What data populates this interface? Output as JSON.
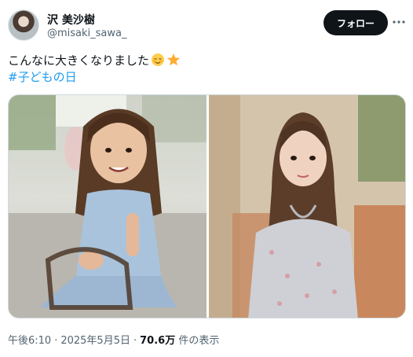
{
  "author": {
    "name": "沢 美沙樹",
    "handle": "@misaki_sawa_",
    "avatar": "avatar-photo"
  },
  "actions": {
    "follow_label": "フォロー",
    "more_icon": "more-horizontal-icon"
  },
  "tweet": {
    "text": "こんなに大きくなりました",
    "emojis": [
      "relieved-face-emoji",
      "star-emoji"
    ],
    "hashtag": "#子どもの日"
  },
  "media": {
    "images": [
      {
        "name": "childhood-photo"
      },
      {
        "name": "current-photo"
      }
    ]
  },
  "meta": {
    "time": "午後6:10",
    "date": "2025年5月5日",
    "views_count": "70.6万",
    "views_label": "件の表示"
  },
  "colors": {
    "link": "#1d9bf0",
    "text_primary": "#0f1419",
    "text_secondary": "#536471",
    "button_bg": "#0f1419"
  }
}
